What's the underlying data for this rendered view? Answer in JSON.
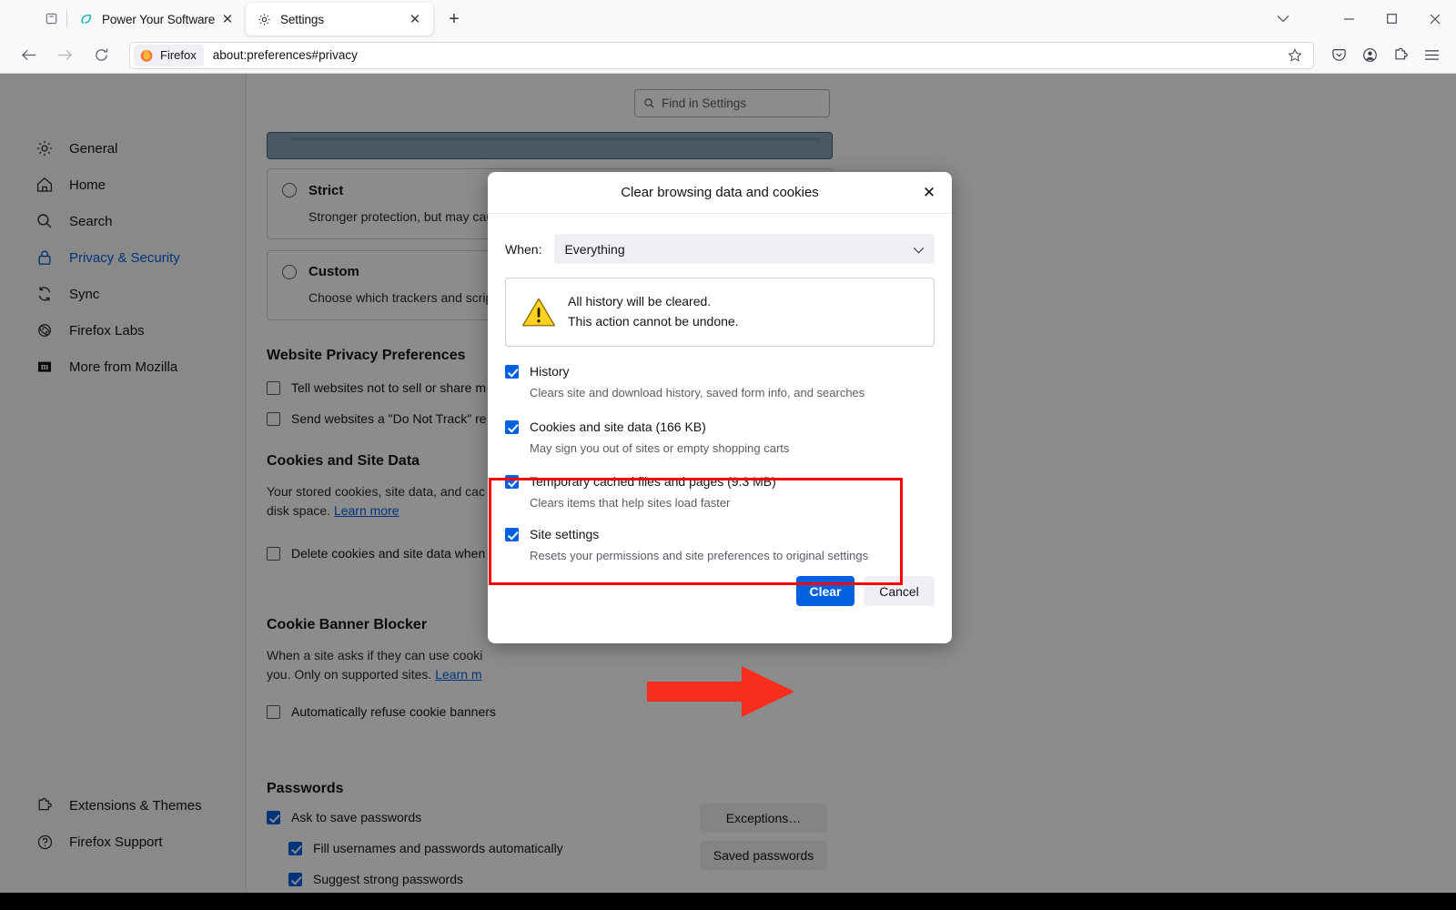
{
  "window": {
    "controls": {
      "list_all_tabs": "list-all-tabs",
      "chevron": "⌄",
      "minimize": "—",
      "maximize": "□",
      "close": "✕"
    }
  },
  "tabs": [
    {
      "title": "Power Your Software Testing wit",
      "favicon": "leaf-icon",
      "active": false,
      "close": "✕"
    },
    {
      "title": "Settings",
      "favicon": "gear-icon",
      "active": true,
      "close": "✕"
    }
  ],
  "newtab_label": "+",
  "navbar": {
    "back": "←",
    "forward": "→",
    "reload": "↻",
    "identity_label": "Firefox",
    "url": "about:preferences#privacy",
    "bookmark_star": "☆",
    "icons": [
      "pocket-icon",
      "account-icon",
      "extensions-icon",
      "menu-icon"
    ]
  },
  "sidebar": {
    "items": [
      {
        "label": "General",
        "icon": "gear-icon",
        "selected": false
      },
      {
        "label": "Home",
        "icon": "home-icon",
        "selected": false
      },
      {
        "label": "Search",
        "icon": "search-icon",
        "selected": false
      },
      {
        "label": "Privacy & Security",
        "icon": "lock-icon",
        "selected": true
      },
      {
        "label": "Sync",
        "icon": "sync-icon",
        "selected": false
      },
      {
        "label": "Firefox Labs",
        "icon": "atom-icon",
        "selected": false
      },
      {
        "label": "More from Mozilla",
        "icon": "mozilla-m-icon",
        "selected": false
      }
    ],
    "bottom_items": [
      {
        "label": "Extensions & Themes",
        "icon": "extensions-icon"
      },
      {
        "label": "Firefox Support",
        "icon": "help-icon"
      }
    ]
  },
  "search": {
    "placeholder": "Find in Settings",
    "icon": "search-icon"
  },
  "settings": {
    "tracking_options": [
      {
        "title": "Strict",
        "title_mnemonic": "r",
        "desc": "Stronger protection, but may cause some sites or content to break.",
        "selected": false,
        "has_chevron": true
      },
      {
        "title": "Custom",
        "title_mnemonic": "C",
        "desc": "Choose which trackers and scripts",
        "selected": false,
        "has_chevron": false
      }
    ],
    "website_privacy": {
      "heading": "Website Privacy Preferences",
      "checkboxes": [
        {
          "label": "Tell websites not to sell or share m",
          "checked": false
        },
        {
          "label": "Send websites a \"Do Not Track\" re",
          "checked": false
        }
      ]
    },
    "cookies": {
      "heading": "Cookies and Site Data",
      "desc_line1": "Your stored cookies, site data, and cac",
      "desc_line2": "disk space.",
      "learn_more": "Learn more",
      "checkbox": {
        "label": "Delete cookies and site data when",
        "checked": false
      }
    },
    "cookie_banner": {
      "heading": "Cookie Banner Blocker",
      "desc_line1": "When a site asks if they can use cooki",
      "desc_line2": "you. Only on supported sites.",
      "learn_more": "Learn m",
      "checkbox": {
        "label": "Automatically refuse cookie banners",
        "checked": false
      }
    },
    "passwords": {
      "heading": "Passwords",
      "checkboxes": [
        {
          "label": "Ask to save passwords",
          "checked": true,
          "indent": false
        },
        {
          "label": "Fill usernames and passwords automatically",
          "checked": true,
          "indent": true
        },
        {
          "label": "Suggest strong passwords",
          "checked": true,
          "indent": true
        }
      ],
      "buttons": [
        "Exceptions…",
        "Saved passwords"
      ]
    }
  },
  "dialog": {
    "title": "Clear browsing data and cookies",
    "close_label": "✕",
    "when_label": "When:",
    "when_mnemonic": "W",
    "when_value": "Everything",
    "warning": {
      "icon": "warning-triangle-icon",
      "line1": "All history will be cleared.",
      "line2": "This action cannot be undone."
    },
    "options": [
      {
        "label": "History",
        "mnemonic": "H",
        "checked": true,
        "desc": "Clears site and download history, saved form info, and searches",
        "highlighted": false
      },
      {
        "label": "Cookies and site data (166 KB)",
        "mnemonic": "e",
        "checked": true,
        "desc": "May sign you out of sites or empty shopping carts",
        "highlighted": true
      },
      {
        "label": "Temporary cached files and pages (9.3 MB)",
        "mnemonic": "f",
        "checked": true,
        "desc": "Clears items that help sites load faster",
        "highlighted": true
      },
      {
        "label": "Site settings",
        "mnemonic": "i",
        "checked": true,
        "desc": "Resets your permissions and site preferences to original settings",
        "highlighted": false
      }
    ],
    "primary_button": "Clear",
    "secondary_button": "Cancel"
  },
  "annotations": {
    "highlight_color": "#ff0000",
    "arrow_color": "#f92d1c",
    "arrow_target": "Clear"
  },
  "colors": {
    "accent_blue": "#0060df",
    "link_blue": "#0060df",
    "chrome_bg": "#f9f9fb",
    "dialog_bg": "#ffffff",
    "highlight_red": "#ff0000"
  }
}
